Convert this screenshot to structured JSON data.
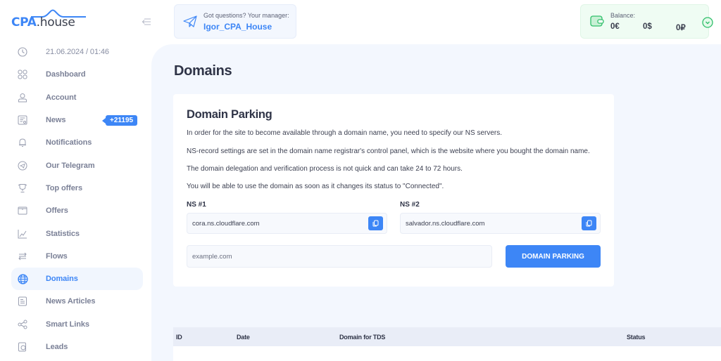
{
  "brand": {
    "logo_cpa": "CPA",
    "logo_house": ".house"
  },
  "sidebar": {
    "datetime": "21.06.2024 / 01:46",
    "items": [
      {
        "label": "Dashboard",
        "icon": "dashboard-icon"
      },
      {
        "label": "Account",
        "icon": "user-icon"
      },
      {
        "label": "News",
        "icon": "news-icon",
        "badge": "+21195"
      },
      {
        "label": "Notifications",
        "icon": "bell-icon"
      },
      {
        "label": "Our Telegram",
        "icon": "telegram-icon"
      },
      {
        "label": "Top offers",
        "icon": "trophy-icon"
      },
      {
        "label": "Offers",
        "icon": "offers-icon"
      },
      {
        "label": "Statistics",
        "icon": "statistics-icon"
      },
      {
        "label": "Flows",
        "icon": "flows-icon"
      },
      {
        "label": "Domains",
        "icon": "globe-icon",
        "active": true
      },
      {
        "label": "News Articles",
        "icon": "article-icon"
      },
      {
        "label": "Smart Links",
        "icon": "share-icon"
      },
      {
        "label": "Leads",
        "icon": "leads-icon"
      }
    ]
  },
  "header": {
    "manager_question": "Got questions? Your manager:",
    "manager_name": "Igor_CPA_House",
    "balance_label": "Balance:",
    "balance_eur": "0€",
    "balance_usd": "0$",
    "balance_rub": "0₽"
  },
  "main": {
    "title": "Domains",
    "card": {
      "title": "Domain Parking",
      "paragraphs": [
        "In order for the site to become available through a domain name, you need to specify our NS servers.",
        "NS-record settings are set in the domain name registrar's control panel, which is the website where you bought the domain name.",
        "The domain delegation and verification process is not quick and can take 24 to 72 hours.",
        "You will be able to use the domain as soon as it changes its status to \"Connected\"."
      ],
      "ns1_label": "NS #1",
      "ns1_value": "cora.ns.cloudflare.com",
      "ns2_label": "NS #2",
      "ns2_value": "salvador.ns.cloudflare.com",
      "domain_placeholder": "example.com",
      "park_button": "DOMAIN PARKING"
    },
    "table": {
      "columns": [
        "ID",
        "Date",
        "Domain for TDS",
        "Status"
      ]
    }
  },
  "colors": {
    "accent": "#3d86f6",
    "main_bg": "#f3f7fe",
    "balance_bg": "#effcf3"
  }
}
